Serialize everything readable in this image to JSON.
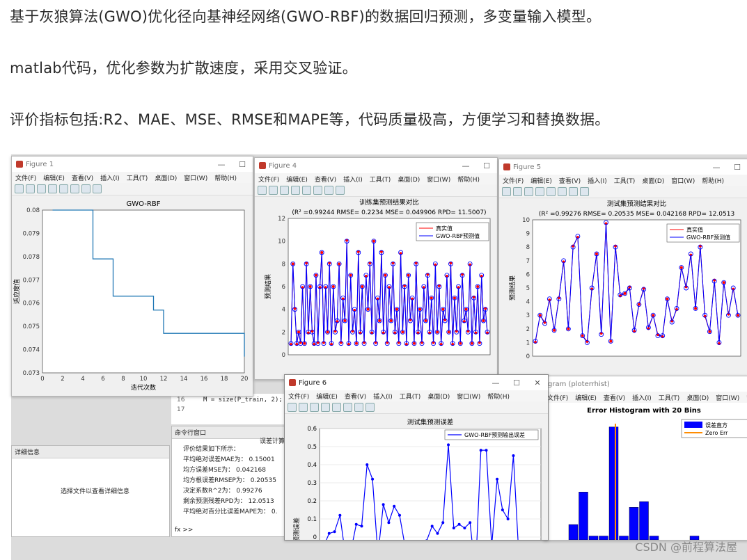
{
  "article": {
    "line1": "基于灰狼算法(GWO)优化径向基神经网络(GWO-RBF)的数据回归预测，多变量输入模型。",
    "line2": "matlab代码，优化参数为扩散速度，采用交叉验证。",
    "line3": "评价指标包括:R2、MAE、MSE、RMSE和MAPE等，代码质量极高，方便学习和替换数据。"
  },
  "figure1": {
    "title": "Figure 1",
    "menu": [
      "文件(F)",
      "编辑(E)",
      "查看(V)",
      "插入(I)",
      "工具(T)",
      "桌面(D)",
      "窗口(W)",
      "帮助(H)"
    ],
    "chart_data": {
      "type": "line",
      "title": "GWO-RBF",
      "xlabel": "迭代次数",
      "ylabel": "适应度值",
      "xlim": [
        0,
        20
      ],
      "ylim": [
        0.073,
        0.08
      ],
      "x_ticks": [
        "0",
        "2",
        "4",
        "6",
        "8",
        "10",
        "12",
        "14",
        "16",
        "18",
        "20"
      ],
      "y_ticks": [
        "0.073",
        "0.074",
        "0.075",
        "0.076",
        "0.077",
        "0.078",
        "0.079",
        "0.08"
      ],
      "x": [
        1,
        2,
        3,
        4,
        5,
        6,
        7,
        8,
        9,
        10,
        11,
        12,
        13,
        14,
        15,
        16,
        17,
        18,
        19,
        20
      ],
      "y": [
        0.08,
        0.08,
        0.08,
        0.08,
        0.0779,
        0.0779,
        0.0763,
        0.0763,
        0.0763,
        0.0763,
        0.0757,
        0.0747,
        0.0747,
        0.0747,
        0.0747,
        0.0747,
        0.0747,
        0.0747,
        0.0747,
        0.0737
      ],
      "color": "#1f77b4"
    }
  },
  "figure4": {
    "title": "Figure 4",
    "menu": [
      "文件(F)",
      "编辑(E)",
      "查看(V)",
      "插入(I)",
      "工具(T)",
      "桌面(D)",
      "窗口(W)",
      "帮助(H)"
    ],
    "chart_data": {
      "type": "line",
      "title": "训练集预测结果对比",
      "subtitle": "(R² =0.99244 RMSE= 0.2234 MSE= 0.049906 RPD= 11.5007)",
      "ylabel": "预测结果",
      "ylim": [
        0,
        12
      ],
      "y_ticks": [
        "0",
        "2",
        "4",
        "6",
        "8",
        "10",
        "12"
      ],
      "series": [
        {
          "name": "真实值",
          "color": "#ff0000"
        },
        {
          "name": "GWO-RBF预测值",
          "color": "#0000ff"
        }
      ],
      "values": [
        1,
        8,
        4,
        1,
        2,
        1,
        6,
        1,
        8,
        2,
        6,
        2,
        1,
        7,
        1,
        6,
        9,
        1,
        6,
        2,
        8,
        1,
        6,
        2,
        3,
        8,
        1,
        5,
        3,
        10,
        1,
        7,
        2,
        4,
        1,
        9,
        2,
        6,
        1,
        7,
        4,
        8,
        2,
        10,
        1,
        5,
        3,
        9,
        2,
        7,
        1,
        6,
        3,
        8,
        2,
        4,
        1,
        9,
        2,
        6,
        1,
        7,
        3,
        5,
        1,
        8,
        2,
        4,
        1,
        6,
        3,
        7,
        2,
        5,
        1,
        8,
        2,
        6,
        1,
        4,
        3,
        7,
        2,
        8,
        1,
        5,
        2,
        6,
        1,
        7,
        3,
        4,
        2,
        8,
        1,
        5,
        2,
        6,
        1,
        7,
        3,
        4,
        2
      ]
    }
  },
  "figure5": {
    "title": "Figure 5",
    "menu": [
      "文件(F)",
      "编辑(E)",
      "查看(V)",
      "插入(I)",
      "工具(T)",
      "桌面(D)",
      "窗口(W)",
      "帮助(H)"
    ],
    "chart_data": {
      "type": "line",
      "title": "测试集预测结果对比",
      "subtitle": "(R² =0.99276 RMSE= 0.20535 MSE= 0.042168 RPD= 12.0513",
      "ylabel": "预测结果",
      "ylim": [
        0,
        10
      ],
      "y_ticks": [
        "0",
        "1",
        "2",
        "3",
        "4",
        "5",
        "6",
        "7",
        "8",
        "9",
        "10"
      ],
      "series": [
        {
          "name": "真实值",
          "color": "#ff0000"
        },
        {
          "name": "GWO-RBF预测值",
          "color": "#0000ff"
        }
      ],
      "values": [
        1.1,
        3,
        2.4,
        4.2,
        1.9,
        4.2,
        7,
        2,
        8,
        8.8,
        1.5,
        1,
        5,
        7.5,
        1.6,
        9.8,
        1.1,
        8,
        4.5,
        4.6,
        5,
        1.9,
        3.8,
        4.9,
        2.1,
        3,
        1.5,
        1.5,
        4.2,
        2.5,
        3.5,
        6.5,
        5,
        7.5,
        3.5,
        8,
        3,
        1.8,
        5.5,
        1,
        5.4,
        3,
        5,
        3
      ]
    }
  },
  "figure6": {
    "title": "Figure 6",
    "menu": [
      "文件(F)",
      "编辑(E)",
      "查看(V)",
      "插入(I)",
      "工具(T)",
      "桌面(D)",
      "窗口(W)",
      "帮助(H)"
    ],
    "chart_data": {
      "type": "line",
      "title": "测试集预测误差",
      "ylabel": "预测误差",
      "ylim": [
        0,
        0.6
      ],
      "y_ticks": [
        "0",
        "0.1",
        "0.2",
        "0.3",
        "0.4",
        "0.5",
        "0.6"
      ],
      "series": [
        {
          "name": "GWO-RBF预测输出误差",
          "color": "#0000ff"
        }
      ],
      "values": [
        -0.05,
        0.02,
        0.03,
        0.12,
        -0.1,
        -0.08,
        0.07,
        0.06,
        0.4,
        0.32,
        -0.1,
        0.18,
        0.08,
        0.17,
        0.12,
        -0.05,
        -0.1,
        -0.12,
        -0.05,
        -0.02,
        0.06,
        0.02,
        0.08,
        0.51,
        0.05,
        0.07,
        0.05,
        0.08,
        -0.2,
        0.48,
        0.48,
        -0.05,
        0.32,
        0.15,
        0.1,
        0.45,
        -0.1,
        -0.05
      ]
    }
  },
  "histogram": {
    "title_fragment": "gram (ploterrhist)",
    "menu": [
      "文件(F)",
      "编辑(E)",
      "查看(V)",
      "插入(I)",
      "工具(T)",
      "桌面(D)",
      "窗口(W)",
      "帮助(H)"
    ],
    "chart_data": {
      "type": "bar",
      "title": "Error Histogram with 20 Bins",
      "legend": [
        "误差直方",
        "Zero Err"
      ],
      "values": [
        0.08,
        0.25,
        0.02,
        0.02,
        0.59,
        0.02,
        0.17,
        0.2,
        0.02,
        0,
        0,
        0,
        0.02
      ],
      "bar_color": "#0000ff",
      "zero_line_color": "#ff8c00"
    }
  },
  "editor": {
    "line16_num": "16",
    "line16_code": "M = size(P_train, 2);",
    "line17_num": "17"
  },
  "command_window": {
    "header": "命令行窗口",
    "side_label": "误差计算",
    "lines": [
      "评价结果如下所示：",
      "平均绝对误差MAE为：  0.15001",
      "均方误差MSE为：       0.042168",
      "均方根误差RMSEP为：   0.20535",
      "决定系数R^2为：       0.99276",
      "剩余预测残差RPD为：   12.0513",
      "平均绝对百分比误差MAPE为：  0."
    ],
    "prompt": "fx >>"
  },
  "details_panel": {
    "header": "详细信息",
    "message": "选择文件以查看详细信息"
  },
  "watermark": "CSDN @前程算法屋"
}
